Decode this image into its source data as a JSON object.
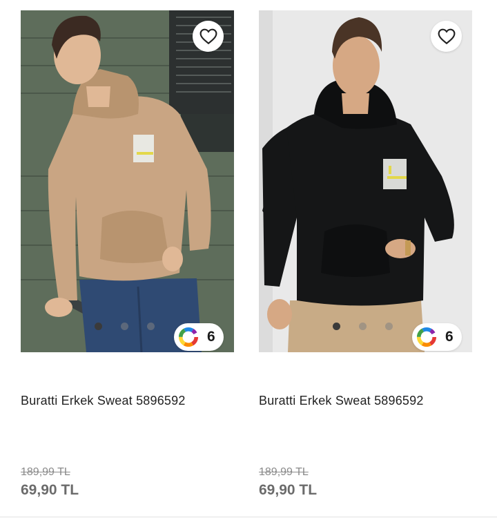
{
  "products": [
    {
      "title": "Buratti Erkek Sweat 5896592",
      "old_price": "189,99 TL",
      "price": "69,90 TL",
      "color_count": "6",
      "image_dots": 3,
      "active_dot": 1,
      "sweatshirt_color": "#c9a583",
      "background_color": "#5d6b5a"
    },
    {
      "title": "Buratti Erkek Sweat 5896592",
      "old_price": "189,99 TL",
      "price": "69,90 TL",
      "color_count": "6",
      "image_dots": 3,
      "active_dot": 1,
      "sweatshirt_color": "#151617",
      "background_color": "#e9e9e9"
    }
  ],
  "icons": {
    "favorite": "heart-outline-icon",
    "colors": "color-wheel-icon"
  }
}
